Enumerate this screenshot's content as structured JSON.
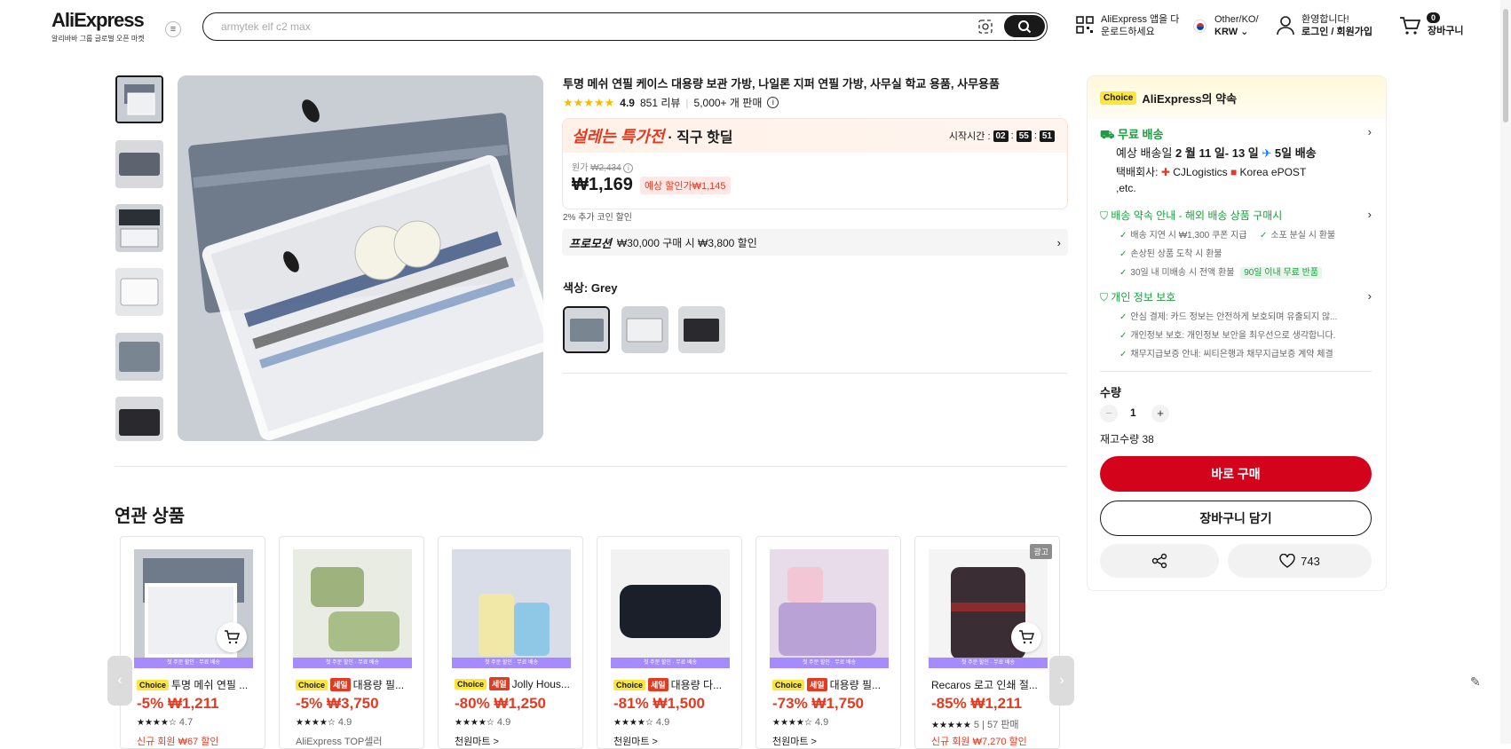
{
  "header": {
    "logo": "AliExpress",
    "logo_sub": "알리바바 그룹 글로벌 오픈 마켓",
    "search_placeholder": "armytek elf c2 max",
    "app_line1": "AliExpress 앱을 다",
    "app_line2": "운로드하세요",
    "region_line1": "Other/KO/",
    "region_line2": "KRW",
    "account_line1": "환영합니다!",
    "account_line2": "로그인 / 회원가입",
    "cart_count": "0",
    "cart_label": "장바구니"
  },
  "product": {
    "title": "투명 메쉬 연필 케이스 대용량 보관 가방, 나일론 지퍼 연필 가방, 사무실 학교 용품, 사무용품",
    "rating": "4.9",
    "reviews": "851 리뷰",
    "sold": "5,000+ 개 판매",
    "deal_brand": "설레는 특가전",
    "deal_sub": "· 직구 핫딜",
    "timer_label": "시작시간 :",
    "timer_h": "02",
    "timer_m": "55",
    "timer_s": "51",
    "orig_label": "원가",
    "orig_price": "₩2,434",
    "price": "₩1,169",
    "expected_disc": "예상 할인가₩1,145",
    "coin": "2% 추가 코인 할인",
    "promo_label": "프로모션",
    "promo_text": "₩30,000 구매 시 ₩3,800 할인",
    "color_label": "색상: Grey"
  },
  "panel": {
    "choice_badge": "Choice",
    "choice_title": "AliExpress의 약속",
    "free_ship": "무료 배송",
    "delivery_prefix": "예상 배송일",
    "delivery_dates": "2 월 11 일- 13 일",
    "delivery_days": "5일 배송",
    "carrier_prefix": "택배회사:",
    "carrier1": "CJLogistics",
    "carrier2": "Korea",
    "carrier3": "ePOST ,etc.",
    "guarantee_title": "배송 약속 안내 - 해외 배송 상품 구매시",
    "g1": "배송 지연 시 ₩1,300 쿠폰 지급",
    "g2": "소포 분실 시 환불",
    "g3": "손상된 상품 도착 시 환불",
    "g4": "30일 내 미배송 시 전액 환불",
    "g4_badge": "90일 이내 무료 반품",
    "privacy_title": "개인 정보 보호",
    "p1": "안심 결제: 카드 정보는 안전하게 보호되며 유출되지 않...",
    "p2": "개인정보 보호: 개인정보 보안을 최우선으로 생각합니다.",
    "p3": "채무지급보증 안내: 씨티은행과 채무지급보증 계약 체결",
    "qty_label": "수량",
    "qty_value": "1",
    "stock": "재고수량 38",
    "buy_now": "바로 구매",
    "add_cart": "장바구니 담기",
    "likes": "743"
  },
  "related": {
    "title": "연관 상품",
    "strip_text": "첫 주문 할인 · 무료 배송",
    "items": [
      {
        "badges": [
          "Choice"
        ],
        "name": "투명 메쉬 연필 ...",
        "price": "-5% ₩1,211",
        "rating": "4.7",
        "extra": "신규 회원 ₩67 할인"
      },
      {
        "badges": [
          "Choice",
          "세일"
        ],
        "name": "대용량 필...",
        "price": "-5% ₩3,750",
        "rating": "4.9",
        "extra": "AliExpress TOP셀러"
      },
      {
        "badges": [
          "Choice",
          "세일"
        ],
        "name": "Jolly Hous...",
        "price": "-80% ₩1,250",
        "rating": "4.9",
        "extra": "천원마트 >"
      },
      {
        "badges": [
          "Choice",
          "세일"
        ],
        "name": "대용량 다...",
        "price": "-81% ₩1,500",
        "rating": "4.9",
        "extra": "천원마트 >"
      },
      {
        "badges": [
          "Choice",
          "세일"
        ],
        "name": "대용량 필...",
        "price": "-73% ₩1,750",
        "rating": "4.9",
        "extra": "천원마트 >"
      },
      {
        "badges": [],
        "name": "Recaros 로고 인쇄 절...",
        "price": "-85% ₩1,211",
        "rating": "5",
        "sold": "57 판매",
        "extra": "신규 회원 ₩7,270 할인",
        "ad": "광고"
      }
    ]
  }
}
